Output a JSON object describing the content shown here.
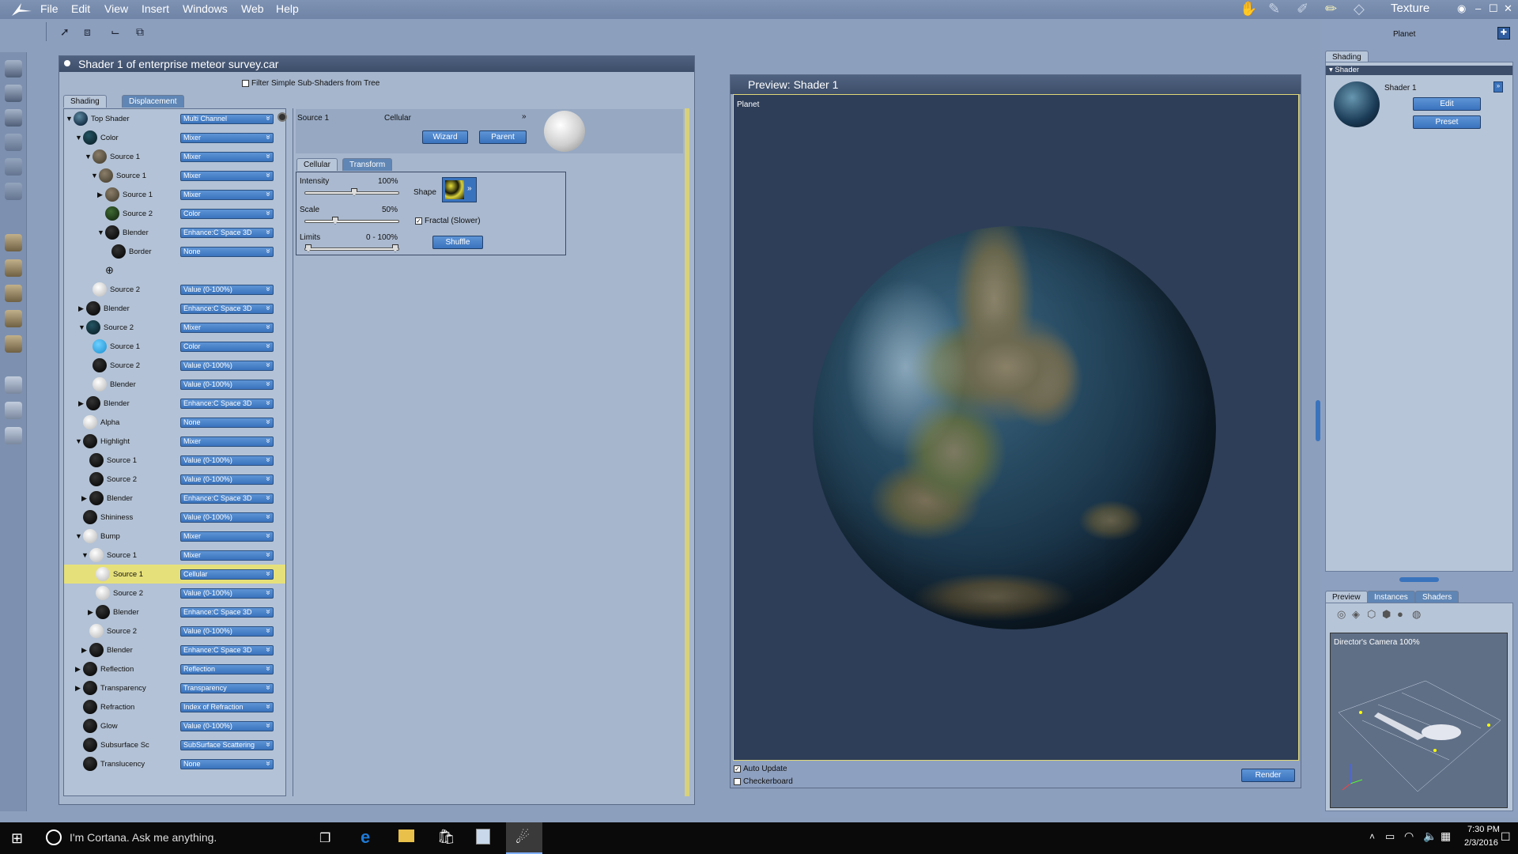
{
  "menubar": {
    "items": [
      "File",
      "Edit",
      "View",
      "Insert",
      "Windows",
      "Web",
      "Help"
    ],
    "room_label": "Texture",
    "window_controls": [
      "eye-icon",
      "minimize-icon",
      "maximize-icon",
      "close-icon"
    ]
  },
  "right_header": {
    "title": "Planet"
  },
  "shader_window": {
    "title": "Shader 1 of enterprise meteor survey.car",
    "filter_label": "Filter Simple Sub-Shaders from Tree",
    "tabs": [
      "Shading",
      "Displacement"
    ],
    "tree": [
      {
        "label": "Top Shader",
        "value": "Multi Channel"
      },
      {
        "label": "Color",
        "value": "Mixer"
      },
      {
        "label": "Source 1",
        "value": "Mixer"
      },
      {
        "label": "Source 1",
        "value": "Mixer"
      },
      {
        "label": "Source 1",
        "value": "Mixer"
      },
      {
        "label": "Source 2",
        "value": "Color"
      },
      {
        "label": "Blender",
        "value": "Enhance:C Space 3D"
      },
      {
        "label": "Border",
        "value": "None"
      },
      {
        "label": "",
        "value": ""
      },
      {
        "label": "Source 2",
        "value": "Value (0-100%)"
      },
      {
        "label": "Blender",
        "value": "Enhance:C Space 3D"
      },
      {
        "label": "Source 2",
        "value": "Mixer"
      },
      {
        "label": "Source 1",
        "value": "Color"
      },
      {
        "label": "Source 2",
        "value": "Value (0-100%)"
      },
      {
        "label": "Blender",
        "value": "Value (0-100%)"
      },
      {
        "label": "Blender",
        "value": "Enhance:C Space 3D"
      },
      {
        "label": "Alpha",
        "value": "None"
      },
      {
        "label": "Highlight",
        "value": "Mixer"
      },
      {
        "label": "Source 1",
        "value": "Value (0-100%)"
      },
      {
        "label": "Source 2",
        "value": "Value (0-100%)"
      },
      {
        "label": "Blender",
        "value": "Enhance:C Space 3D"
      },
      {
        "label": "Shininess",
        "value": "Value (0-100%)"
      },
      {
        "label": "Bump",
        "value": "Mixer"
      },
      {
        "label": "Source 1",
        "value": "Mixer"
      },
      {
        "label": "Source 1",
        "value": "Cellular"
      },
      {
        "label": "Source 2",
        "value": "Value (0-100%)"
      },
      {
        "label": "Blender",
        "value": "Enhance:C Space 3D"
      },
      {
        "label": "Source 2",
        "value": "Value (0-100%)"
      },
      {
        "label": "Blender",
        "value": "Enhance:C Space 3D"
      },
      {
        "label": "Reflection",
        "value": "Reflection"
      },
      {
        "label": "Transparency",
        "value": "Transparency"
      },
      {
        "label": "Refraction",
        "value": "Index of Refraction"
      },
      {
        "label": "Glow",
        "value": "Value (0-100%)"
      },
      {
        "label": "Subsurface Sc",
        "value": "SubSurface Scattering"
      },
      {
        "label": "Translucency",
        "value": "None"
      }
    ],
    "source": {
      "label": "Source 1",
      "type": "Cellular",
      "wizard_button": "Wizard",
      "parent_button": "Parent",
      "tabs": [
        "Cellular",
        "Transform"
      ],
      "intensity_label": "Intensity",
      "intensity_value": "100%",
      "intensity": 1.0,
      "scale_label": "Scale",
      "scale_value": "50%",
      "scale": 0.5,
      "limits_label": "Limits",
      "limits_value": "0 - 100%",
      "shape_label": "Shape",
      "fractal_label": "Fractal (Slower)",
      "shuffle_button": "Shuffle"
    }
  },
  "preview_window": {
    "title": "Preview: Shader 1",
    "object_label": "Planet",
    "auto_update_label": "Auto Update",
    "checkerboard_label": "Checkerboard",
    "render_button": "Render"
  },
  "shading_panel": {
    "tab": "Shading",
    "section": "Shader",
    "shader_name": "Shader 1",
    "edit_button": "Edit",
    "preset_button": "Preset"
  },
  "preview_panel": {
    "tabs": [
      "Preview",
      "Instances",
      "Shaders"
    ],
    "camera_label": "Director's Camera 100%"
  },
  "taskbar": {
    "search_placeholder": "I'm Cortana. Ask me anything.",
    "time": "7:30 PM",
    "date": "2/3/2016"
  }
}
